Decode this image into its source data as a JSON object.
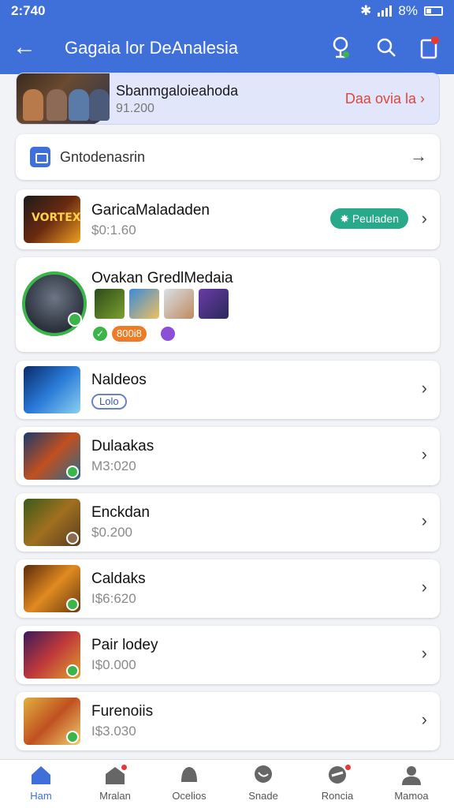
{
  "status_bar": {
    "time": "2:740",
    "battery": "8%"
  },
  "app_bar": {
    "title": "Gagaia lor DeAnalesia"
  },
  "hero": {
    "title": "Sbanmgaloieahoda",
    "price": "91.200",
    "link": "Daa ovia la"
  },
  "category": {
    "label": "Gntodenasrin"
  },
  "featured": {
    "title": "GaricaMaladaden",
    "price": "$0:1.60",
    "status": "Peuladen"
  },
  "creator": {
    "name": "Ovakan GredlMedaia",
    "tag": "800i8"
  },
  "items": [
    {
      "title": "Naldeos",
      "chip": "Lolo"
    },
    {
      "title": "Dulaakas",
      "price": "M3:020"
    },
    {
      "title": "Enckdan",
      "price": "$0.200"
    },
    {
      "title": "Caldaks",
      "price": "I$6:620"
    },
    {
      "title": "Pair lodey",
      "price": "I$0.000"
    },
    {
      "title": "Furenoiis",
      "price": "I$3.030"
    }
  ],
  "bottom_nav": [
    {
      "label": "Ham",
      "icon": "home-icon",
      "active": true
    },
    {
      "label": "Mralan",
      "icon": "store-icon"
    },
    {
      "label": "Ocelios",
      "icon": "bell-icon"
    },
    {
      "label": "Snade",
      "icon": "chat-icon"
    },
    {
      "label": "Roncia",
      "icon": "controller-icon"
    },
    {
      "label": "Mamoa",
      "icon": "profile-icon"
    }
  ],
  "colors": {
    "primary": "#3f6fd8",
    "accent_red": "#e0453b",
    "green": "#3bb54a",
    "teal": "#27a98a",
    "orange": "#f07b27"
  }
}
